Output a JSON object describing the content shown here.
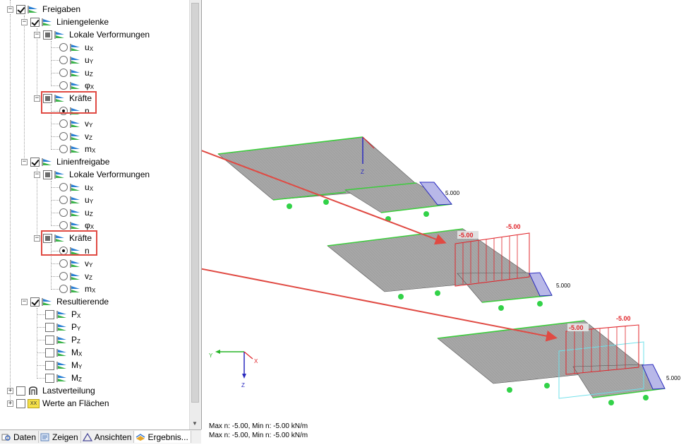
{
  "tree": {
    "freigaben": "Freigaben",
    "liniengelenke": "Liniengelenke",
    "lokale_verformungen_1": "Lokale Verformungen",
    "ux": "u",
    "uy": "u",
    "uz": "u",
    "phix": "φ",
    "sub_x": "X",
    "sub_y": "Y",
    "sub_z": "Z",
    "kraefte_1": "Kräfte",
    "n": "n",
    "v": "v",
    "m": "m",
    "linienfreigabe": "Linienfreigabe",
    "lokale_verformungen_2": "Lokale Verformungen",
    "kraefte_2": "Kräfte",
    "resultierende": "Resultierende",
    "P": "P",
    "M": "M",
    "lastverteilung": "Lastverteilung",
    "werte_an_flaechen": "Werte an Flächen",
    "xx_badge": "XX"
  },
  "tabs": [
    "Daten",
    "Zeigen",
    "Ansichten",
    "Ergebnis..."
  ],
  "view": {
    "load_labels": [
      "5.000",
      "5.000",
      "5.000"
    ],
    "result_labels": [
      "-5.00",
      "-5.00",
      "-5.00",
      "-5.00"
    ],
    "axis_labels": {
      "x": "X",
      "y": "Y",
      "z": "Z"
    }
  },
  "status": {
    "line1": "Max n: -5.00, Min n: -5.00 kN/m",
    "line2": "Max n: -5.00, Min n: -5.00 kN/m"
  },
  "colors": {
    "highlight": "#e04a43",
    "plate": "#a8a8a8",
    "edge": "#3ccd3c",
    "result": "#e0242a",
    "load": "#2a2abf"
  }
}
